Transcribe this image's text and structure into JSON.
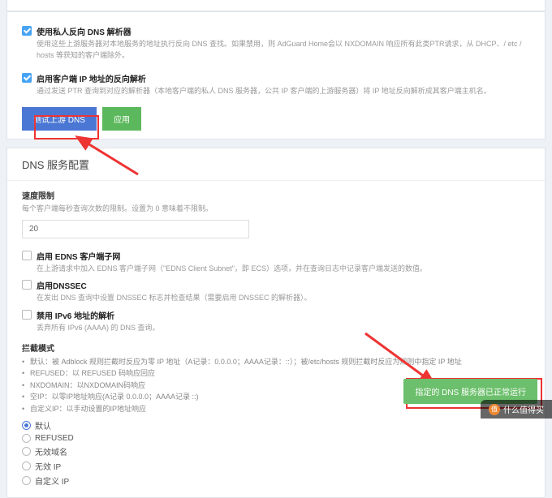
{
  "topOptions": {
    "reverseDns": {
      "label": "使用私人反向 DNS 解析器",
      "desc": "使用这些上游服务器对本地服务的地址执行反向 DNS 查找。如果禁用，则 AdGuard Home会以 NXDOMAIN 响应所有此类PTR请求，从 DHCP、/ etc / hosts 等获知的客户端除外。"
    },
    "clientIp": {
      "label": "启用客户端 IP 地址的反向解析",
      "desc": "通过发送 PTR 查询到对应的解析器（本地客户端的私人 DNS 服务器，公共 IP 客户端的上游服务器）将 IP 地址反向解析成其客户端主机名。"
    }
  },
  "buttons": {
    "test": "测试上游 DNS",
    "apply": "应用"
  },
  "sectionTitle": "DNS 服务配置",
  "rateLimit": {
    "title": "速度限制",
    "desc": "每个客户端每秒查询次数的限制。设置为 0 意味着不限制。",
    "value": "20"
  },
  "options": {
    "edns": {
      "label": "启用 EDNS 客户端子网",
      "desc": "在上游请求中加入 EDNS 客户端子网（\"EDNS Client Subnet\"，即 ECS）选项，并在查询日志中记录客户端发送的数值。"
    },
    "dnssec": {
      "label": "启用DNSSEC",
      "desc": "在发出 DNS 查询中设置 DNSSEC 标志并检查结果（需要启用 DNSSEC 的解析器）。"
    },
    "ipv6": {
      "label": "禁用 IPv6 地址的解析",
      "desc": "丢弃所有 IPv6 (AAAA) 的 DNS 查询。"
    }
  },
  "blockMode": {
    "title": "拦截模式",
    "bullets": [
      "默认：被 Adblock 规则拦截时反应为零 IP 地址（A记录：0.0.0.0；AAAA记录：::）；被/etc/hosts 规则拦截时反应为规则中指定 IP 地址",
      "REFUSED：以 REFUSED 码响应回应",
      "NXDOMAIN：以NXDOMAIN码响应",
      "空IP：以零IP地址响应(A记录 0.0.0.0；AAAA记录 ::)",
      "自定义IP：以手动设置的IP地址响应"
    ],
    "radios": [
      "默认",
      "REFUSED",
      "无效域名",
      "无效 IP",
      "自定义 IP"
    ]
  },
  "toast": "指定的 DNS 服务器已正常运行",
  "watermark": "什么值得买",
  "watermarkBadge": "值"
}
